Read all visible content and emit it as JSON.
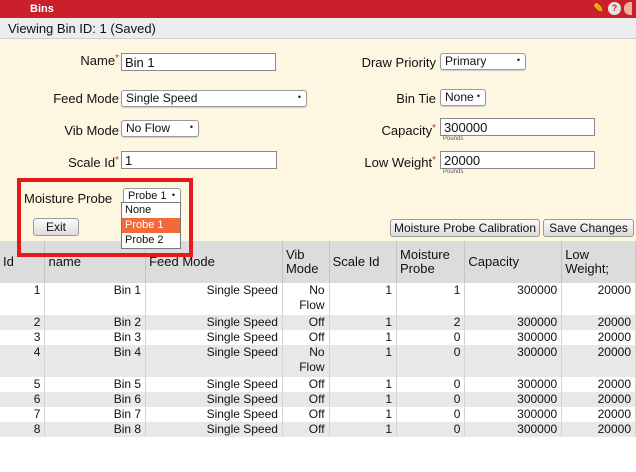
{
  "window": {
    "title": "Bins"
  },
  "status": {
    "text": "Viewing Bin ID: 1 (Saved)"
  },
  "form": {
    "name_label": "Name",
    "name_value": "Bin 1",
    "feed_mode_label": "Feed Mode",
    "feed_mode_value": "Single Speed",
    "vib_mode_label": "Vib Mode",
    "vib_mode_value": "No Flow",
    "scale_id_label": "Scale Id",
    "scale_id_value": "1",
    "moisture_probe_label": "Moisture Probe",
    "moisture_probe_value": "Probe 1",
    "draw_priority_label": "Draw Priority",
    "draw_priority_value": "Primary",
    "bin_tie_label": "Bin Tie",
    "bin_tie_value": "None",
    "capacity_label": "Capacity",
    "capacity_value": "300000",
    "capacity_unit": "Pounds",
    "low_weight_label": "Low Weight",
    "low_weight_value": "20000",
    "low_weight_unit": "Pounds",
    "required_marker": "*"
  },
  "moisture_dropdown": {
    "options": [
      "None",
      "Probe 1",
      "Probe 2"
    ],
    "selected": "Probe 1"
  },
  "buttons": {
    "exit": "Exit",
    "moisture_calibration": "Moisture Probe Calibration",
    "save_changes": "Save Changes"
  },
  "table": {
    "columns": [
      "Id",
      "name",
      "Feed Mode",
      "Vib Mode",
      "Scale Id",
      "Moisture Probe",
      "Capacity",
      "Low Weight;"
    ],
    "rows": [
      [
        "1",
        "Bin 1",
        "Single Speed",
        "No Flow",
        "1",
        "1",
        "300000",
        "20000"
      ],
      [
        "2",
        "Bin 2",
        "Single Speed",
        "Off",
        "1",
        "2",
        "300000",
        "20000"
      ],
      [
        "3",
        "Bin 3",
        "Single Speed",
        "Off",
        "1",
        "0",
        "300000",
        "20000"
      ],
      [
        "4",
        "Bin 4",
        "Single Speed",
        "No Flow",
        "1",
        "0",
        "300000",
        "20000"
      ],
      [
        "5",
        "Bin 5",
        "Single Speed",
        "Off",
        "1",
        "0",
        "300000",
        "20000"
      ],
      [
        "6",
        "Bin 6",
        "Single Speed",
        "Off",
        "1",
        "0",
        "300000",
        "20000"
      ],
      [
        "7",
        "Bin 7",
        "Single Speed",
        "Off",
        "1",
        "0",
        "300000",
        "20000"
      ],
      [
        "8",
        "Bin 8",
        "Single Speed",
        "Off",
        "1",
        "0",
        "300000",
        "20000"
      ]
    ]
  },
  "icons": {
    "pin": "pin-icon",
    "help": "help-icon",
    "close": "close-icon"
  },
  "colors": {
    "titlebar": "#c9202c",
    "form_bg": "#fdf7e2",
    "highlight": "#e51b1b",
    "selected_option": "#f26a3a"
  }
}
